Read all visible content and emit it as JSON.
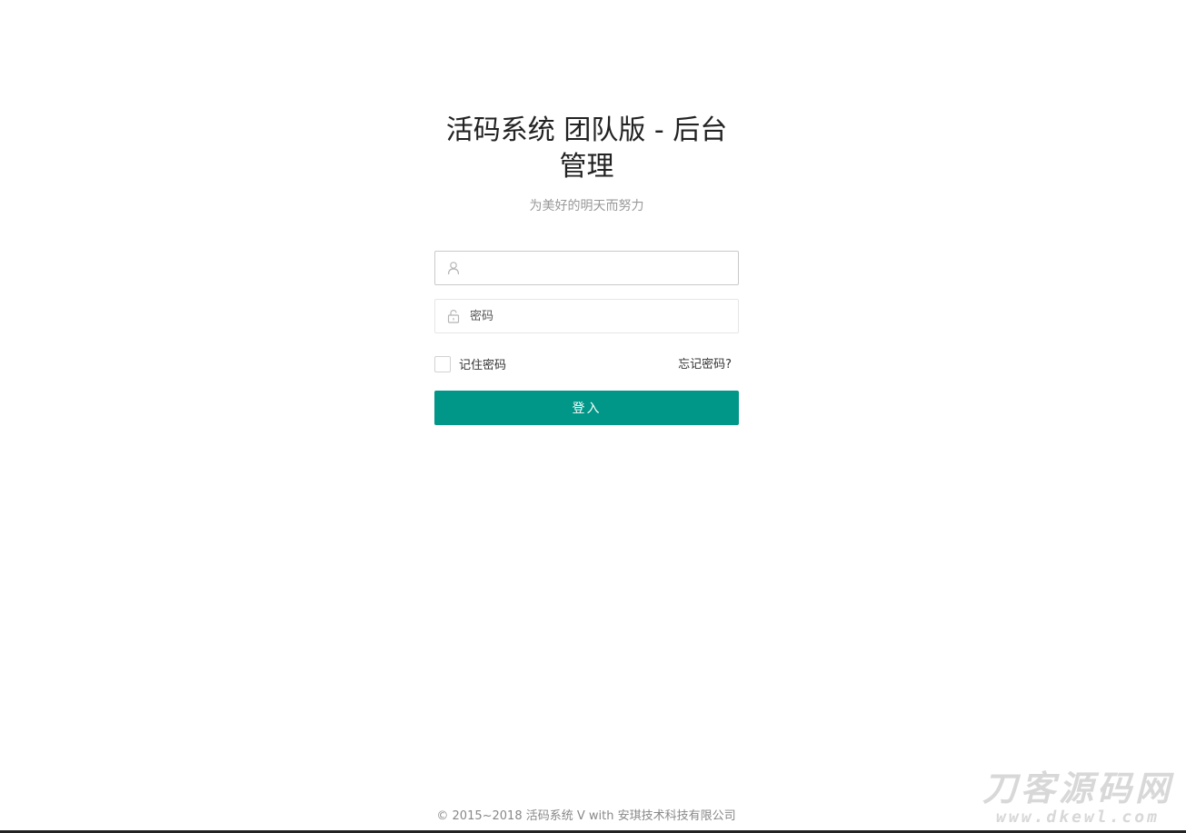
{
  "header": {
    "title": "活码系统 团队版 - 后台管理",
    "subtitle": "为美好的明天而努力"
  },
  "form": {
    "username": {
      "icon": "user-icon",
      "value": "",
      "placeholder": ""
    },
    "password": {
      "icon": "lock-icon",
      "value": "",
      "placeholder": "密码"
    },
    "remember_label": "记住密码",
    "remember_checked": false,
    "forgot_label": "忘记密码?",
    "submit_label": "登入"
  },
  "footer": {
    "copyright": "© 2015~2018 活码系统 V with 安琪技术科技有限公司"
  },
  "watermark": {
    "main": "刀客源码网",
    "sub": "www.dkewl.com"
  },
  "colors": {
    "primary": "#009688",
    "border": "#e6e6e6",
    "muted_text": "#999999"
  }
}
